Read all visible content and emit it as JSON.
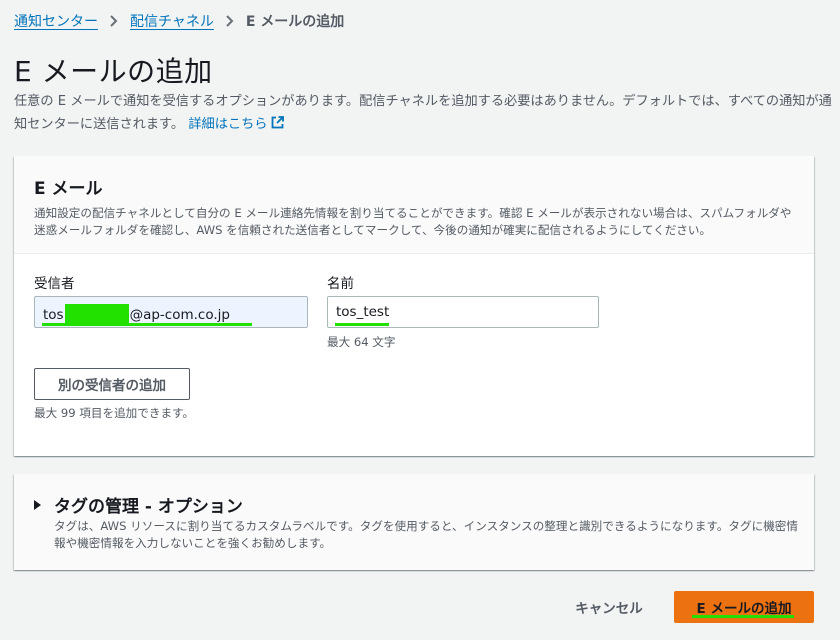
{
  "breadcrumb": {
    "items": [
      "通知センター",
      "配信チャネル"
    ],
    "current": "E メールの追加"
  },
  "page": {
    "title": "E メールの追加",
    "description": "任意の E メールで通知を受信するオプションがあります。配信チャネルを追加する必要はありません。デフォルトでは、すべての通知が通知センターに送信されます。",
    "learn_more": "詳細はこちら"
  },
  "email_panel": {
    "title": "E メール",
    "description": "通知設定の配信チャネルとして自分の E メール連絡先情報を割り当てることができます。確認 E メールが表示されない場合は、スパムフォルダや迷惑メールフォルダを確認し、AWS を信頼された送信者としてマークして、今後の通知が確実に配信されるようにしてください。",
    "recipient_label": "受信者",
    "recipient_prefix": "tos",
    "recipient_suffix": "@ap-com.co.jp",
    "name_label": "名前",
    "name_value": "tos_test",
    "name_hint": "最大 64 文字",
    "add_recipient_button": "別の受信者の追加",
    "add_recipient_hint": "最大 99 項目を追加できます。"
  },
  "tags_panel": {
    "title": "タグの管理 - オプション",
    "description": "タグは、AWS リソースに割り当てるカスタムラベルです。タグを使用すると、インスタンスの整理と識別できるようになります。タグに機密情報や機密情報を入力しないことを強くお勧めします。"
  },
  "actions": {
    "cancel": "キャンセル",
    "submit": "E メールの追加"
  },
  "colors": {
    "link": "#0073bb",
    "primary": "#ec7211",
    "highlight": "#22e000"
  }
}
